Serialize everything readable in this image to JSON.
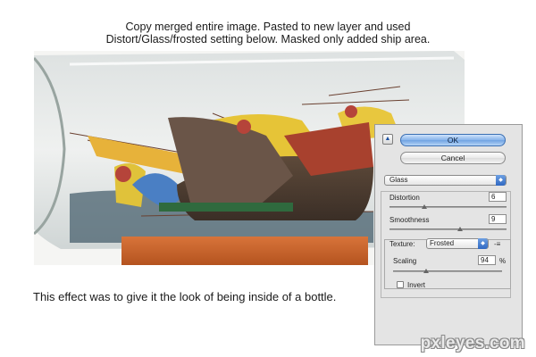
{
  "captions": {
    "top_line1": "Copy merged entire image. Pasted to new layer and used",
    "top_line2": "Distort/Glass/frosted setting below. Masked only added ship area.",
    "bottom": "This effect was to give it the look of being inside of a bottle."
  },
  "watermark": "pxleyes.com",
  "dialog": {
    "collapse_icon": "triangle-up-icon",
    "ok_label": "OK",
    "cancel_label": "Cancel",
    "filter_selected": "Glass",
    "distortion": {
      "label": "Distortion",
      "value": "6",
      "level": 0.3
    },
    "smoothness": {
      "label": "Smoothness",
      "value": "9",
      "level": 0.6
    },
    "texture": {
      "label": "Texture:",
      "selected": "Frosted",
      "menu_icon": "flyout-menu-icon"
    },
    "scaling": {
      "label": "Scaling",
      "value": "94",
      "unit": "%",
      "level": 0.3
    },
    "invert_label": "Invert"
  },
  "colors": {
    "ok_button": "#86b3ea",
    "select_arrow": "#2f68c2",
    "dialog_bg": "#e4e4e4"
  }
}
